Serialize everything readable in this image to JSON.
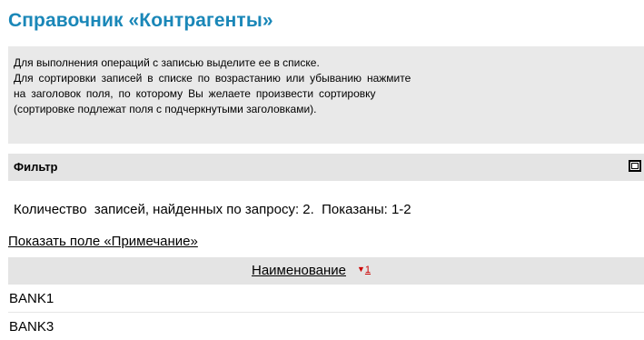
{
  "page": {
    "title": "Справочник «Контрагенты»"
  },
  "info": {
    "lines": [
      "Для выполнения операций с записью выделите ее в списке.",
      "Для сортировки записей в списке по возрастанию или убыванию нажмите",
      "на заголовок поля, по которому Вы желаете произвести сортировку",
      "(сортировке подлежат поля с подчеркнутыми заголовками)."
    ]
  },
  "filter": {
    "label": "Фильтр",
    "toggle_icon": "expand-box-icon"
  },
  "results": {
    "count_text": "Количество  записей, найденных по запросу:",
    "count_value": "2.",
    "shown_label": "Показаны:",
    "shown_range": "1-2"
  },
  "links": {
    "show_notes": "Показать поле «Примечание»"
  },
  "table": {
    "columns": [
      {
        "label": "Наименование",
        "sort_arrow": "▼",
        "sort_order": "1"
      }
    ],
    "rows": [
      {
        "name": "BANK1"
      },
      {
        "name": "BANK3"
      }
    ]
  },
  "colors": {
    "title": "#1a87b8",
    "panel_bg": "#e9e9e9",
    "header_bg": "#e4e4e4",
    "sort_indicator": "#cc0000"
  }
}
